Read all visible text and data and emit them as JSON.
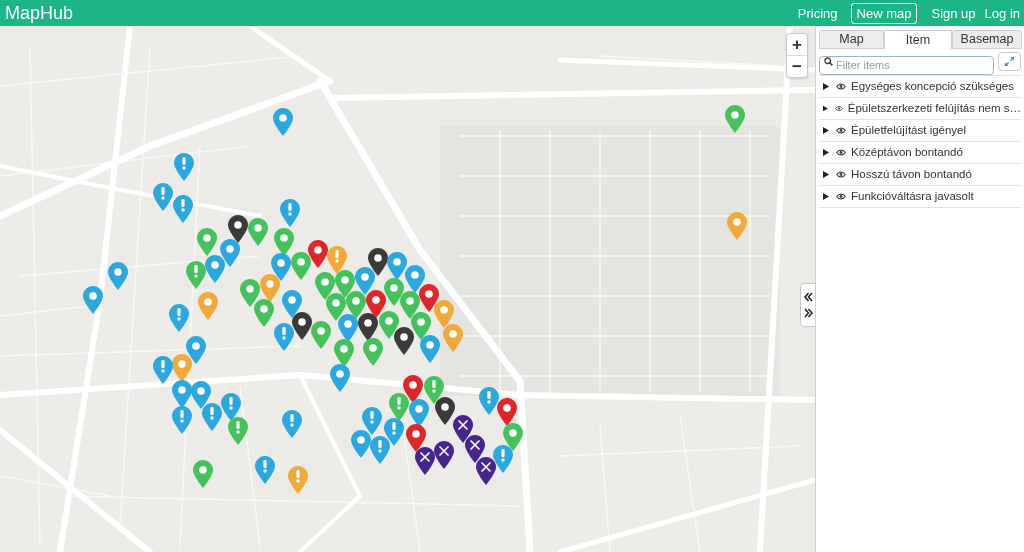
{
  "header": {
    "logo": "MapHub",
    "nav": [
      {
        "label": "Pricing",
        "kind": "link"
      },
      {
        "label": "New map",
        "kind": "button"
      },
      {
        "label": "Sign up",
        "kind": "link"
      },
      {
        "label": "Log in",
        "kind": "link"
      }
    ]
  },
  "map": {
    "zoom_in": "+",
    "zoom_out": "−"
  },
  "sidebar": {
    "tabs": [
      {
        "label": "Map",
        "selected": false
      },
      {
        "label": "Item",
        "selected": true
      },
      {
        "label": "Basemap",
        "selected": false
      }
    ],
    "filter": {
      "placeholder": "Filter items"
    },
    "items": [
      {
        "label": "Egységes koncepció szükséges",
        "expanded": false,
        "visible": true
      },
      {
        "label": "Épületszerkezeti felújítás nem s…",
        "expanded": false,
        "visible": true
      },
      {
        "label": "Épületfelújítást igényel",
        "expanded": false,
        "visible": true
      },
      {
        "label": "Középtávon bontandó",
        "expanded": false,
        "visible": true
      },
      {
        "label": "Hosszú távon bontandó",
        "expanded": false,
        "visible": true
      },
      {
        "label": "Funkcióváltásra javasolt",
        "expanded": false,
        "visible": true
      }
    ]
  }
}
